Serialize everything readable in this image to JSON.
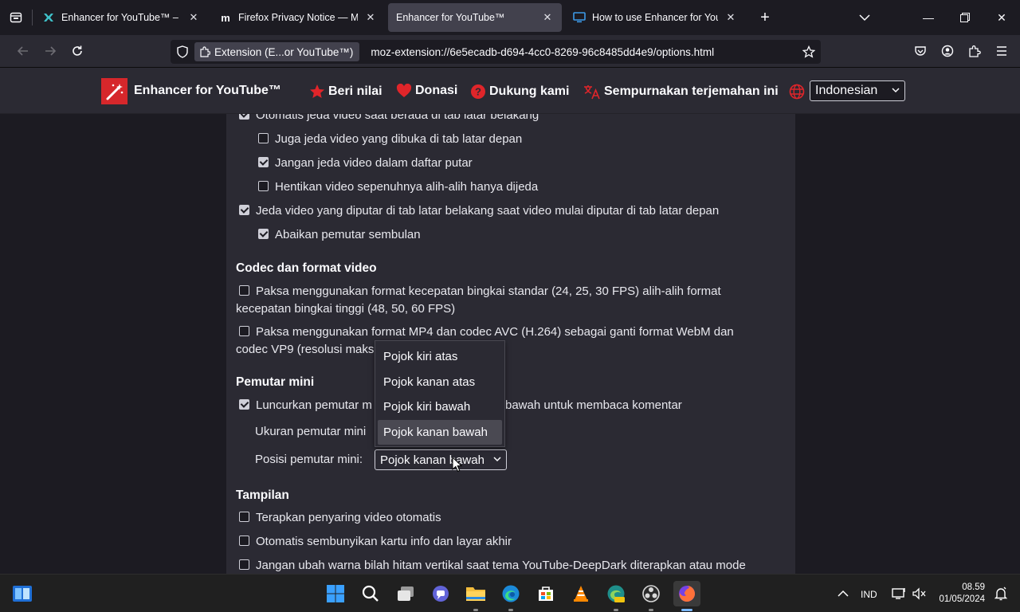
{
  "tabs": [
    {
      "title": "Enhancer for YouTube™ – Get th",
      "active": false
    },
    {
      "title": "Firefox Privacy Notice — Mozill",
      "active": false
    },
    {
      "title": "Enhancer for YouTube™",
      "active": true
    },
    {
      "title": "How to use Enhancer for YouTu",
      "active": false
    }
  ],
  "navbar": {
    "identity_label": "Extension (E...or YouTube™)",
    "url": "moz-extension://6e5ecadb-d694-4cc0-8269-96c8485dd4e9/options.html"
  },
  "header": {
    "title": "Enhancer for YouTube™",
    "rate": "Beri nilai",
    "donate": "Donasi",
    "support": "Dukung kami",
    "translate": "Sempurnakan terjemahan ini",
    "language": "Indonesian"
  },
  "options": {
    "bg_pause": "Otomatis jeda video saat berada di tab latar belakang",
    "bg_pause_fg": "Juga jeda video yang dibuka di tab latar depan",
    "bg_pause_playlist": "Jangan jeda video dalam daftar putar",
    "bg_stop": "Hentikan video sepenuhnya alih-alih hanya dijeda",
    "fg_pause": "Jeda video yang diputar di tab latar belakang saat video mulai diputar di tab latar depan",
    "fg_ignore_popup": "Abaikan pemutar sembulan",
    "codec_heading": "Codec dan format video",
    "codec_fps_line1": "Paksa menggunakan format kecepatan bingkai standar (24, 25, 30 FPS) alih-alih format",
    "codec_fps_line2": "kecepatan bingkai tinggi (48, 50, 60 FPS)",
    "codec_mp4_line1": "Paksa menggunakan format MP4 dan codec AVC (H.264) sebagai ganti format WebM dan",
    "codec_mp4_line2": "codec VP9 (resolusi maks",
    "mini_heading": "Pemutar mini",
    "mini_launch_a": "Luncurkan pemutar m",
    "mini_launch_b": "bawah untuk membaca komentar",
    "mini_size_label": "Ukuran pemutar mini",
    "mini_pos_label": "Posisi pemutar mini:",
    "mini_pos_value": "Pojok kanan bawah",
    "mini_pos_options": [
      "Pojok kiri atas",
      "Pojok kanan atas",
      "Pojok kiri bawah",
      "Pojok kanan bawah"
    ],
    "display_heading": "Tampilan",
    "display_filter": "Terapkan penyaring video otomatis",
    "display_cards": "Otomatis sembunyikan kartu info dan layar akhir",
    "display_bars": "Jangan ubah warna bilah hitam vertikal saat tema YouTube-DeepDark diterapkan atau mode"
  },
  "taskbar": {
    "lang": "IND",
    "time": "08.59",
    "date": "01/05/2024"
  },
  "colors": {
    "accent_red": "#d6272b",
    "panel": "#2b2a33",
    "background": "#1c1b22"
  }
}
